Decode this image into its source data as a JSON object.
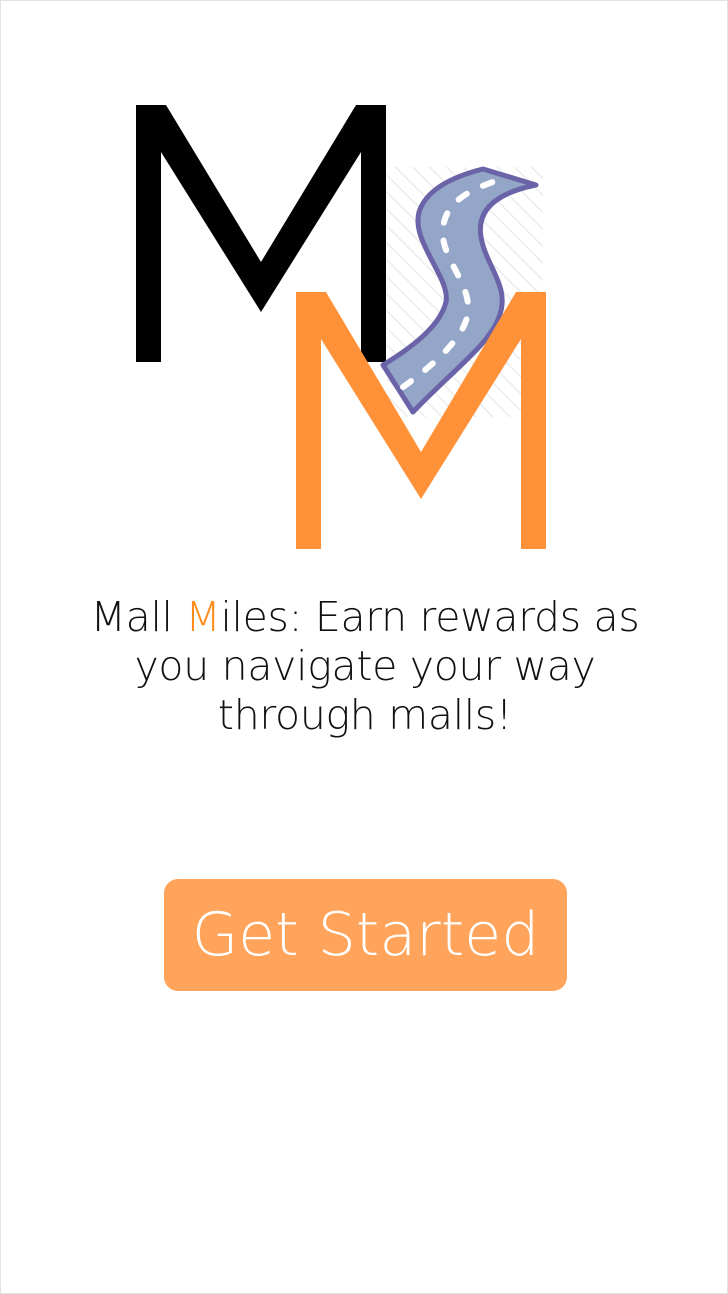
{
  "logo": {
    "letters": [
      "M",
      "M"
    ],
    "primary_color": "#000000",
    "accent_color": "#ff9238",
    "road_color": "#94a6c8",
    "road_edge_color": "#6a63a8"
  },
  "tagline": {
    "part1": "Mall ",
    "accent_letter": "M",
    "part2": "iles: Earn rewards as you navigate your way through malls!",
    "accent_color": "#ff8c1a"
  },
  "cta": {
    "label": "Get Started",
    "color": "#ffa45a"
  }
}
